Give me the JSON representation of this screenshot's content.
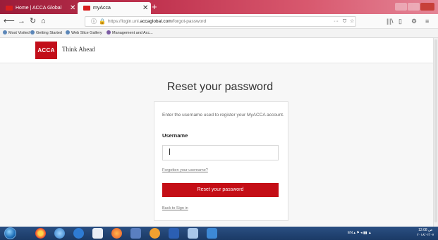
{
  "browser": {
    "tabs": [
      {
        "label": "Home | ACCA Global",
        "close": "✕"
      },
      {
        "label": "myAcca",
        "close": "✕"
      }
    ],
    "new_tab": "+",
    "nav": {
      "back": "⟵",
      "forward": "→",
      "reload": "↻",
      "home": "⌂"
    },
    "url_prefix": "https://login.uni.",
    "url_domain": "accaglobal.com",
    "url_path": "/forgot-password",
    "url_actions": {
      "more": "···",
      "pocket": "⛉",
      "star": "☆"
    },
    "toolbar": {
      "library": "|||\\",
      "sidebar": "▯",
      "extensions": "⚙",
      "menu": "≡"
    },
    "bookmarks": [
      "Most Visited",
      "Getting Started",
      "Web Slice Gallery",
      "Management and Acc..."
    ]
  },
  "site": {
    "logo_text": "ACCA",
    "tagline": "Think Ahead"
  },
  "form": {
    "title": "Reset your password",
    "instructions": "Enter the username used to register your MyACCA account.",
    "username_label": "Username",
    "username_value": "",
    "forgot_link": "Forgotten your username?",
    "submit_label": "Reset your password",
    "back_link": "Back to Sign in"
  },
  "taskbar": {
    "tray_text": "EN",
    "clock_time": "12:08 ص",
    "clock_date": "٢٠١٨/٠٢/٠٧"
  },
  "colors": {
    "accent_red": "#c40e16",
    "titlebar": "#9b1d3a",
    "taskbar": "#1b3a66"
  }
}
